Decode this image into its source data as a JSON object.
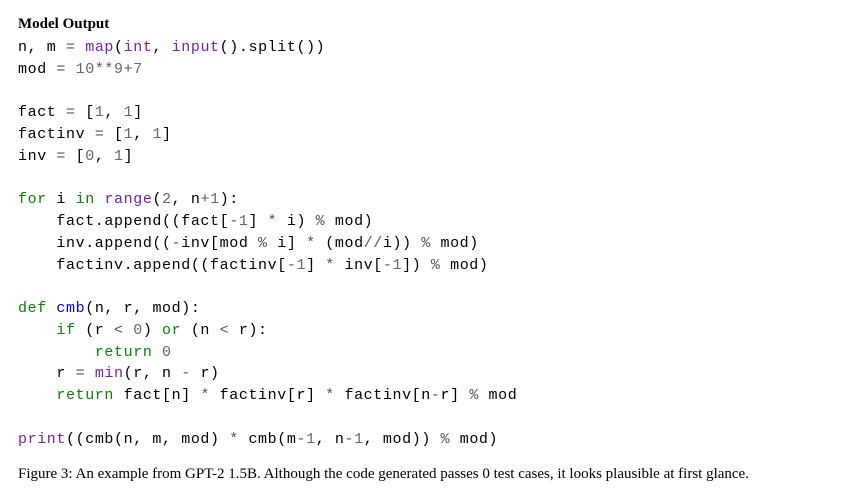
{
  "heading": "Model Output",
  "code": {
    "lines": [
      [
        {
          "cls": "id",
          "t": "n, m "
        },
        {
          "cls": "op",
          "t": "= "
        },
        {
          "cls": "bi",
          "t": "map"
        },
        {
          "cls": "id",
          "t": "("
        },
        {
          "cls": "bi",
          "t": "int"
        },
        {
          "cls": "id",
          "t": ", "
        },
        {
          "cls": "bi",
          "t": "input"
        },
        {
          "cls": "id",
          "t": "().split())"
        }
      ],
      [
        {
          "cls": "id",
          "t": "mod "
        },
        {
          "cls": "op",
          "t": "= "
        },
        {
          "cls": "num",
          "t": "10"
        },
        {
          "cls": "op",
          "t": "**"
        },
        {
          "cls": "num",
          "t": "9"
        },
        {
          "cls": "op",
          "t": "+"
        },
        {
          "cls": "num",
          "t": "7"
        }
      ],
      [],
      [
        {
          "cls": "id",
          "t": "fact "
        },
        {
          "cls": "op",
          "t": "= "
        },
        {
          "cls": "id",
          "t": "["
        },
        {
          "cls": "num",
          "t": "1"
        },
        {
          "cls": "id",
          "t": ", "
        },
        {
          "cls": "num",
          "t": "1"
        },
        {
          "cls": "id",
          "t": "]"
        }
      ],
      [
        {
          "cls": "id",
          "t": "factinv "
        },
        {
          "cls": "op",
          "t": "= "
        },
        {
          "cls": "id",
          "t": "["
        },
        {
          "cls": "num",
          "t": "1"
        },
        {
          "cls": "id",
          "t": ", "
        },
        {
          "cls": "num",
          "t": "1"
        },
        {
          "cls": "id",
          "t": "]"
        }
      ],
      [
        {
          "cls": "id",
          "t": "inv "
        },
        {
          "cls": "op",
          "t": "= "
        },
        {
          "cls": "id",
          "t": "["
        },
        {
          "cls": "num",
          "t": "0"
        },
        {
          "cls": "id",
          "t": ", "
        },
        {
          "cls": "num",
          "t": "1"
        },
        {
          "cls": "id",
          "t": "]"
        }
      ],
      [],
      [
        {
          "cls": "kw",
          "t": "for"
        },
        {
          "cls": "id",
          "t": " i "
        },
        {
          "cls": "kw",
          "t": "in"
        },
        {
          "cls": "id",
          "t": " "
        },
        {
          "cls": "bi",
          "t": "range"
        },
        {
          "cls": "id",
          "t": "("
        },
        {
          "cls": "num",
          "t": "2"
        },
        {
          "cls": "id",
          "t": ", n"
        },
        {
          "cls": "op",
          "t": "+"
        },
        {
          "cls": "num",
          "t": "1"
        },
        {
          "cls": "id",
          "t": "):"
        }
      ],
      [
        {
          "cls": "id",
          "t": "    fact.append((fact["
        },
        {
          "cls": "op",
          "t": "-"
        },
        {
          "cls": "num",
          "t": "1"
        },
        {
          "cls": "id",
          "t": "] "
        },
        {
          "cls": "op",
          "t": "* "
        },
        {
          "cls": "id",
          "t": "i) "
        },
        {
          "cls": "op",
          "t": "% "
        },
        {
          "cls": "id",
          "t": "mod)"
        }
      ],
      [
        {
          "cls": "id",
          "t": "    inv.append(("
        },
        {
          "cls": "op",
          "t": "-"
        },
        {
          "cls": "id",
          "t": "inv[mod "
        },
        {
          "cls": "op",
          "t": "% "
        },
        {
          "cls": "id",
          "t": "i] "
        },
        {
          "cls": "op",
          "t": "* "
        },
        {
          "cls": "id",
          "t": "(mod"
        },
        {
          "cls": "op",
          "t": "//"
        },
        {
          "cls": "id",
          "t": "i)) "
        },
        {
          "cls": "op",
          "t": "% "
        },
        {
          "cls": "id",
          "t": "mod)"
        }
      ],
      [
        {
          "cls": "id",
          "t": "    factinv.append((factinv["
        },
        {
          "cls": "op",
          "t": "-"
        },
        {
          "cls": "num",
          "t": "1"
        },
        {
          "cls": "id",
          "t": "] "
        },
        {
          "cls": "op",
          "t": "* "
        },
        {
          "cls": "id",
          "t": "inv["
        },
        {
          "cls": "op",
          "t": "-"
        },
        {
          "cls": "num",
          "t": "1"
        },
        {
          "cls": "id",
          "t": "]) "
        },
        {
          "cls": "op",
          "t": "% "
        },
        {
          "cls": "id",
          "t": "mod)"
        }
      ],
      [],
      [
        {
          "cls": "kw",
          "t": "def"
        },
        {
          "cls": "id",
          "t": " "
        },
        {
          "cls": "fn",
          "t": "cmb"
        },
        {
          "cls": "id",
          "t": "(n, r, mod):"
        }
      ],
      [
        {
          "cls": "id",
          "t": "    "
        },
        {
          "cls": "kw",
          "t": "if"
        },
        {
          "cls": "id",
          "t": " (r "
        },
        {
          "cls": "op",
          "t": "< "
        },
        {
          "cls": "num",
          "t": "0"
        },
        {
          "cls": "id",
          "t": ") "
        },
        {
          "cls": "kw",
          "t": "or"
        },
        {
          "cls": "id",
          "t": " (n "
        },
        {
          "cls": "op",
          "t": "< "
        },
        {
          "cls": "id",
          "t": "r):"
        }
      ],
      [
        {
          "cls": "id",
          "t": "        "
        },
        {
          "cls": "kw",
          "t": "return"
        },
        {
          "cls": "id",
          "t": " "
        },
        {
          "cls": "num",
          "t": "0"
        }
      ],
      [
        {
          "cls": "id",
          "t": "    r "
        },
        {
          "cls": "op",
          "t": "= "
        },
        {
          "cls": "bi",
          "t": "min"
        },
        {
          "cls": "id",
          "t": "(r, n "
        },
        {
          "cls": "op",
          "t": "- "
        },
        {
          "cls": "id",
          "t": "r)"
        }
      ],
      [
        {
          "cls": "id",
          "t": "    "
        },
        {
          "cls": "kw",
          "t": "return"
        },
        {
          "cls": "id",
          "t": " fact[n] "
        },
        {
          "cls": "op",
          "t": "* "
        },
        {
          "cls": "id",
          "t": "factinv[r] "
        },
        {
          "cls": "op",
          "t": "* "
        },
        {
          "cls": "id",
          "t": "factinv[n"
        },
        {
          "cls": "op",
          "t": "-"
        },
        {
          "cls": "id",
          "t": "r] "
        },
        {
          "cls": "op",
          "t": "% "
        },
        {
          "cls": "id",
          "t": "mod"
        }
      ],
      [],
      [
        {
          "cls": "bi",
          "t": "print"
        },
        {
          "cls": "id",
          "t": "((cmb(n, m, mod) "
        },
        {
          "cls": "op",
          "t": "* "
        },
        {
          "cls": "id",
          "t": "cmb(m"
        },
        {
          "cls": "op",
          "t": "-"
        },
        {
          "cls": "num",
          "t": "1"
        },
        {
          "cls": "id",
          "t": ", n"
        },
        {
          "cls": "op",
          "t": "-"
        },
        {
          "cls": "num",
          "t": "1"
        },
        {
          "cls": "id",
          "t": ", mod)) "
        },
        {
          "cls": "op",
          "t": "% "
        },
        {
          "cls": "id",
          "t": "mod)"
        }
      ]
    ]
  },
  "caption": "Figure 3: An example from GPT-2 1.5B. Although the code generated passes 0 test cases, it looks plausible at first glance."
}
